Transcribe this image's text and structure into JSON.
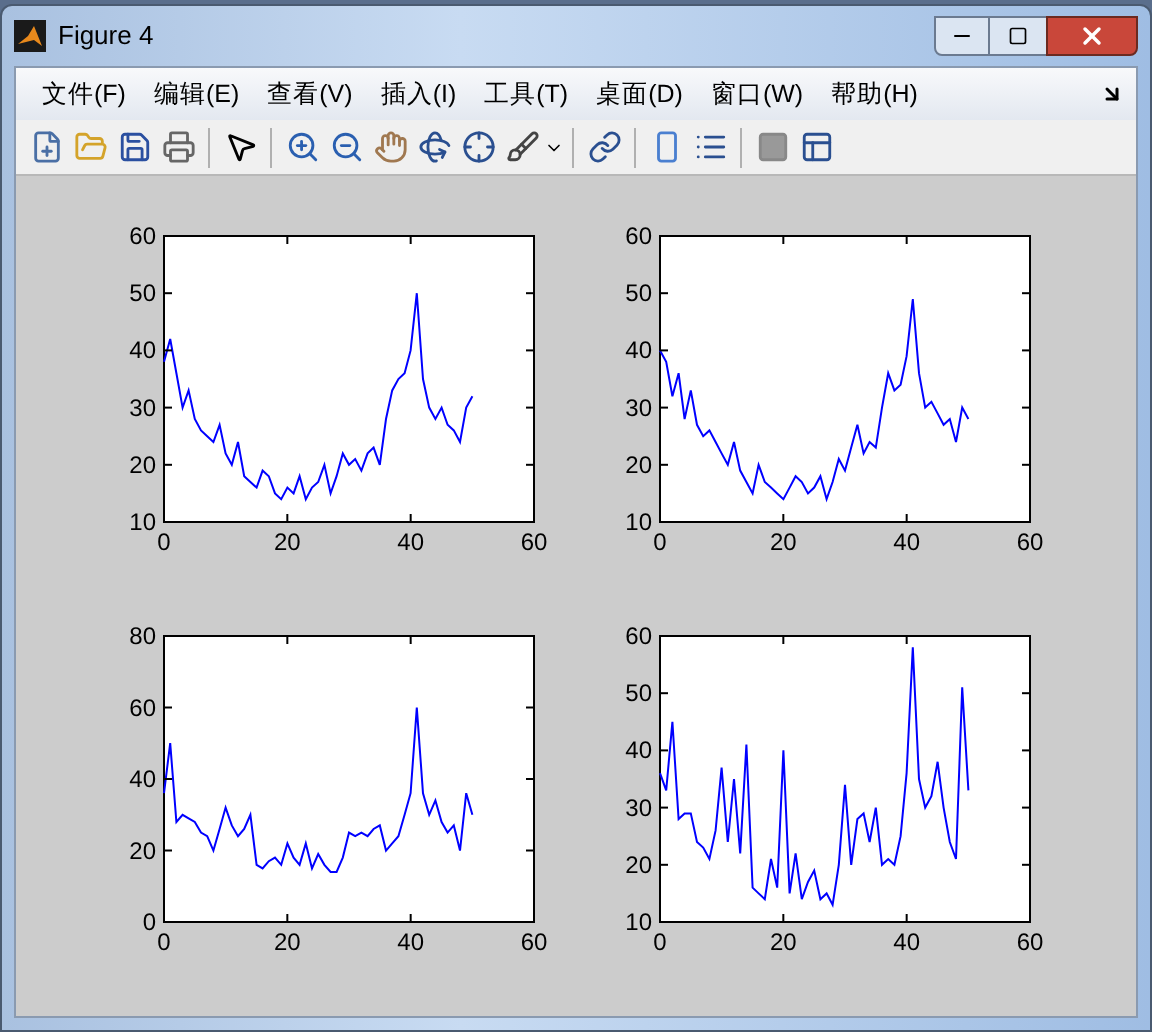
{
  "window": {
    "title": "Figure 4"
  },
  "menu": [
    {
      "label": "文件(F)"
    },
    {
      "label": "编辑(E)"
    },
    {
      "label": "查看(V)"
    },
    {
      "label": "插入(I)"
    },
    {
      "label": "工具(T)"
    },
    {
      "label": "桌面(D)"
    },
    {
      "label": "窗口(W)"
    },
    {
      "label": "帮助(H)"
    }
  ],
  "axes": [
    {
      "chart_data": {
        "type": "line",
        "x": [
          0,
          1,
          2,
          3,
          4,
          5,
          6,
          7,
          8,
          9,
          10,
          11,
          12,
          13,
          14,
          15,
          16,
          17,
          18,
          19,
          20,
          21,
          22,
          23,
          24,
          25,
          26,
          27,
          28,
          29,
          30,
          31,
          32,
          33,
          34,
          35,
          36,
          37,
          38,
          39,
          40,
          41,
          42,
          43,
          44,
          45,
          46,
          47,
          48,
          49,
          50
        ],
        "series": [
          {
            "color": "#0000ff",
            "values": [
              38,
              42,
              36,
              30,
              33,
              28,
              26,
              25,
              24,
              27,
              22,
              20,
              24,
              18,
              17,
              16,
              19,
              18,
              15,
              14,
              16,
              15,
              18,
              14,
              16,
              17,
              20,
              15,
              18,
              22,
              20,
              21,
              19,
              22,
              23,
              20,
              28,
              33,
              35,
              36,
              40,
              50,
              35,
              30,
              28,
              30,
              27,
              26,
              24,
              30,
              32
            ]
          }
        ],
        "xlim": [
          0,
          60
        ],
        "ylim": [
          10,
          60
        ],
        "xticks": [
          0,
          20,
          40,
          60
        ],
        "yticks": [
          10,
          20,
          30,
          40,
          50,
          60
        ]
      }
    },
    {
      "chart_data": {
        "type": "line",
        "x": [
          0,
          1,
          2,
          3,
          4,
          5,
          6,
          7,
          8,
          9,
          10,
          11,
          12,
          13,
          14,
          15,
          16,
          17,
          18,
          19,
          20,
          21,
          22,
          23,
          24,
          25,
          26,
          27,
          28,
          29,
          30,
          31,
          32,
          33,
          34,
          35,
          36,
          37,
          38,
          39,
          40,
          41,
          42,
          43,
          44,
          45,
          46,
          47,
          48,
          49,
          50
        ],
        "series": [
          {
            "color": "#0000ff",
            "values": [
              40,
              38,
              32,
              36,
              28,
              33,
              27,
              25,
              26,
              24,
              22,
              20,
              24,
              19,
              17,
              15,
              20,
              17,
              16,
              15,
              14,
              16,
              18,
              17,
              15,
              16,
              18,
              14,
              17,
              21,
              19,
              23,
              27,
              22,
              24,
              23,
              30,
              36,
              33,
              34,
              39,
              49,
              36,
              30,
              31,
              29,
              27,
              28,
              24,
              30,
              28
            ]
          }
        ],
        "xlim": [
          0,
          60
        ],
        "ylim": [
          10,
          60
        ],
        "xticks": [
          0,
          20,
          40,
          60
        ],
        "yticks": [
          10,
          20,
          30,
          40,
          50,
          60
        ]
      }
    },
    {
      "chart_data": {
        "type": "line",
        "x": [
          0,
          1,
          2,
          3,
          4,
          5,
          6,
          7,
          8,
          9,
          10,
          11,
          12,
          13,
          14,
          15,
          16,
          17,
          18,
          19,
          20,
          21,
          22,
          23,
          24,
          25,
          26,
          27,
          28,
          29,
          30,
          31,
          32,
          33,
          34,
          35,
          36,
          37,
          38,
          39,
          40,
          41,
          42,
          43,
          44,
          45,
          46,
          47,
          48,
          49,
          50
        ],
        "series": [
          {
            "color": "#0000ff",
            "values": [
              36,
              50,
              28,
              30,
              29,
              28,
              25,
              24,
              20,
              26,
              32,
              27,
              24,
              26,
              30,
              16,
              15,
              17,
              18,
              16,
              22,
              18,
              16,
              22,
              15,
              19,
              16,
              14,
              14,
              18,
              25,
              24,
              25,
              24,
              26,
              27,
              20,
              22,
              24,
              30,
              36,
              60,
              36,
              30,
              34,
              28,
              25,
              27,
              20,
              36,
              30
            ]
          }
        ],
        "xlim": [
          0,
          60
        ],
        "ylim": [
          0,
          80
        ],
        "xticks": [
          0,
          20,
          40,
          60
        ],
        "yticks": [
          0,
          20,
          40,
          60,
          80
        ]
      }
    },
    {
      "chart_data": {
        "type": "line",
        "x": [
          0,
          1,
          2,
          3,
          4,
          5,
          6,
          7,
          8,
          9,
          10,
          11,
          12,
          13,
          14,
          15,
          16,
          17,
          18,
          19,
          20,
          21,
          22,
          23,
          24,
          25,
          26,
          27,
          28,
          29,
          30,
          31,
          32,
          33,
          34,
          35,
          36,
          37,
          38,
          39,
          40,
          41,
          42,
          43,
          44,
          45,
          46,
          47,
          48,
          49,
          50
        ],
        "series": [
          {
            "color": "#0000ff",
            "values": [
              36,
              33,
              45,
              28,
              29,
              29,
              24,
              23,
              21,
              26,
              37,
              24,
              35,
              22,
              41,
              16,
              15,
              14,
              21,
              16,
              40,
              15,
              22,
              14,
              17,
              19,
              14,
              15,
              13,
              20,
              34,
              20,
              28,
              29,
              24,
              30,
              20,
              21,
              20,
              25,
              36,
              58,
              35,
              30,
              32,
              38,
              30,
              24,
              21,
              51,
              33
            ]
          }
        ],
        "xlim": [
          0,
          60
        ],
        "ylim": [
          10,
          60
        ],
        "xticks": [
          0,
          20,
          40,
          60
        ],
        "yticks": [
          10,
          20,
          30,
          40,
          50,
          60
        ]
      }
    }
  ]
}
